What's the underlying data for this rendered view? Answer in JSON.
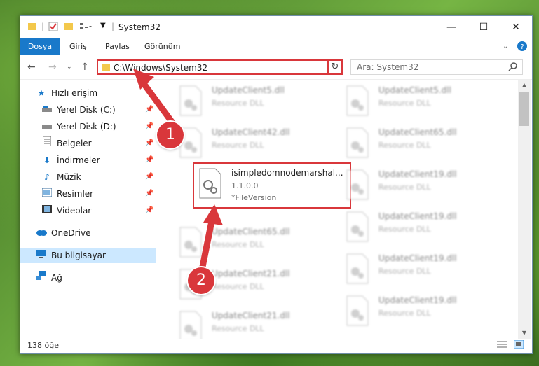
{
  "window": {
    "title": "System32",
    "controls": {
      "minimize": "—",
      "maximize": "☐",
      "close": "✕"
    }
  },
  "ribbon": {
    "file": "Dosya",
    "tabs": [
      "Giriş",
      "Paylaş",
      "Görünüm"
    ]
  },
  "nav": {
    "address": "C:\\Windows\\System32",
    "search_placeholder": "Ara: System32"
  },
  "sidebar": {
    "quick_access": "Hızlı erişim",
    "items": [
      {
        "label": "Yerel Disk (C:)",
        "icon": "drive-icon"
      },
      {
        "label": "Yerel Disk (D:)",
        "icon": "drive-icon"
      },
      {
        "label": "Belgeler",
        "icon": "documents-icon"
      },
      {
        "label": "İndirmeler",
        "icon": "download-icon"
      },
      {
        "label": "Müzik",
        "icon": "music-icon"
      },
      {
        "label": "Resimler",
        "icon": "pictures-icon"
      },
      {
        "label": "Videolar",
        "icon": "videos-icon"
      }
    ],
    "onedrive": "OneDrive",
    "this_pc": "Bu bilgisayar",
    "network": "Ağ"
  },
  "files": {
    "left": [
      {
        "name": "UpdateClient5.dll",
        "type": "Resource DLL"
      },
      {
        "name": "UpdateClient42.dll",
        "type": "Resource DLL"
      },
      {
        "name": "isimpledomnodemarshal...",
        "version": "1.1.0.0",
        "extra": "*FileVersion"
      },
      {
        "name": "UpdateClient65.dll",
        "type": "Resource DLL"
      },
      {
        "name": "UpdateClient21.dll",
        "type": "Resource DLL"
      },
      {
        "name": "UpdateClient21.dll",
        "type": "Resource DLL"
      }
    ],
    "right": [
      {
        "name": "UpdateClient5.dll",
        "type": "Resource DLL"
      },
      {
        "name": "UpdateClient65.dll",
        "type": "Resource DLL"
      },
      {
        "name": "UpdateClient19.dll",
        "type": "Resource DLL"
      },
      {
        "name": "UpdateClient19.dll",
        "type": "Resource DLL"
      },
      {
        "name": "UpdateClient19.dll",
        "type": "Resource DLL"
      },
      {
        "name": "UpdateClient19.dll",
        "type": "Resource DLL"
      }
    ]
  },
  "status": {
    "count": "138 öğe"
  },
  "callouts": [
    "1",
    "2"
  ],
  "colors": {
    "accent": "#1979ca",
    "highlight": "#d9373b",
    "selected": "#cce8ff"
  }
}
